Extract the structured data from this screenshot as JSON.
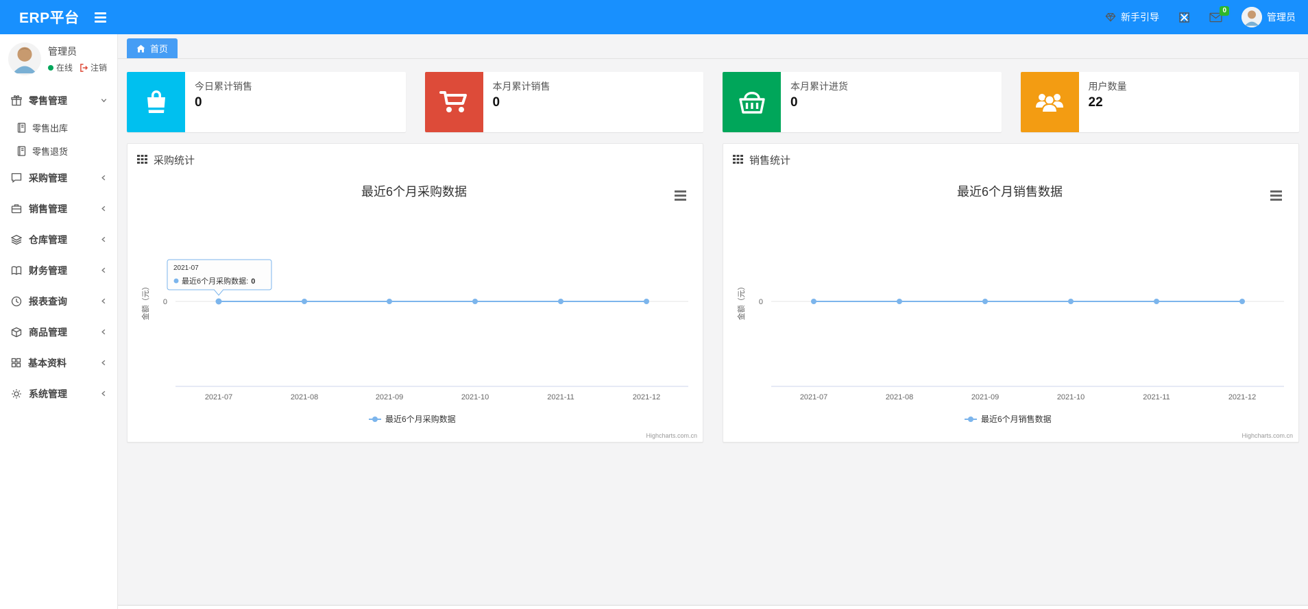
{
  "navbar": {
    "brand": "ERP平台",
    "guide_label": "新手引导",
    "mail_badge": "0",
    "user_name": "管理员"
  },
  "sidebar": {
    "user": {
      "name": "管理员",
      "status": "在线",
      "logout_label": "注销"
    },
    "items": [
      {
        "label": "零售管理",
        "icon": "gift-icon",
        "expanded": true,
        "children": [
          {
            "label": "零售出库",
            "icon": "ledger-icon"
          },
          {
            "label": "零售退货",
            "icon": "ledger-icon"
          }
        ]
      },
      {
        "label": "采购管理",
        "icon": "chat-icon"
      },
      {
        "label": "销售管理",
        "icon": "briefcase-icon"
      },
      {
        "label": "仓库管理",
        "icon": "layers-icon"
      },
      {
        "label": "财务管理",
        "icon": "open-book-icon"
      },
      {
        "label": "报表查询",
        "icon": "clock-icon"
      },
      {
        "label": "商品管理",
        "icon": "package-icon"
      },
      {
        "label": "基本资料",
        "icon": "grid-icon"
      },
      {
        "label": "系统管理",
        "icon": "gear-icon"
      }
    ]
  },
  "tabbar": {
    "home_label": "首页"
  },
  "stats": [
    {
      "label": "今日累计销售",
      "value": "0",
      "color": "#00c0ef",
      "icon": "shopping-bag-icon"
    },
    {
      "label": "本月累计销售",
      "value": "0",
      "color": "#dd4b39",
      "icon": "cart-icon"
    },
    {
      "label": "本月累计进货",
      "value": "0",
      "color": "#00a65a",
      "icon": "basket-icon"
    },
    {
      "label": "用户数量",
      "value": "22",
      "color": "#f39c12",
      "icon": "users-icon"
    }
  ],
  "colors": {
    "navbar": "#1890fe",
    "tab_active": "#459df5",
    "series": "#7cb5ec",
    "mail_badge": "#2eb82a"
  },
  "chart_data": [
    {
      "type": "line",
      "panel_title": "采购统计",
      "title": "最近6个月采购数据",
      "x": [
        "2021-07",
        "2021-08",
        "2021-09",
        "2021-10",
        "2021-11",
        "2021-12"
      ],
      "series": [
        {
          "name": "最近6个月采购数据",
          "values": [
            0,
            0,
            0,
            0,
            0,
            0
          ],
          "color": "#7cb5ec"
        }
      ],
      "xlabel": "",
      "ylabel": "金额（元）",
      "yticks": [
        "0"
      ],
      "grid": "zero-line only",
      "legend_position": "bottom",
      "tooltip": {
        "header": "2021-07",
        "label": "最近6个月采购数据:",
        "value": "0"
      },
      "credit": "Highcharts.com.cn"
    },
    {
      "type": "line",
      "panel_title": "销售统计",
      "title": "最近6个月销售数据",
      "x": [
        "2021-07",
        "2021-08",
        "2021-09",
        "2021-10",
        "2021-11",
        "2021-12"
      ],
      "series": [
        {
          "name": "最近6个月销售数据",
          "values": [
            0,
            0,
            0,
            0,
            0,
            0
          ],
          "color": "#7cb5ec"
        }
      ],
      "xlabel": "",
      "ylabel": "金额（元）",
      "yticks": [
        "0"
      ],
      "grid": "zero-line only",
      "legend_position": "bottom",
      "credit": "Highcharts.com.cn"
    }
  ]
}
